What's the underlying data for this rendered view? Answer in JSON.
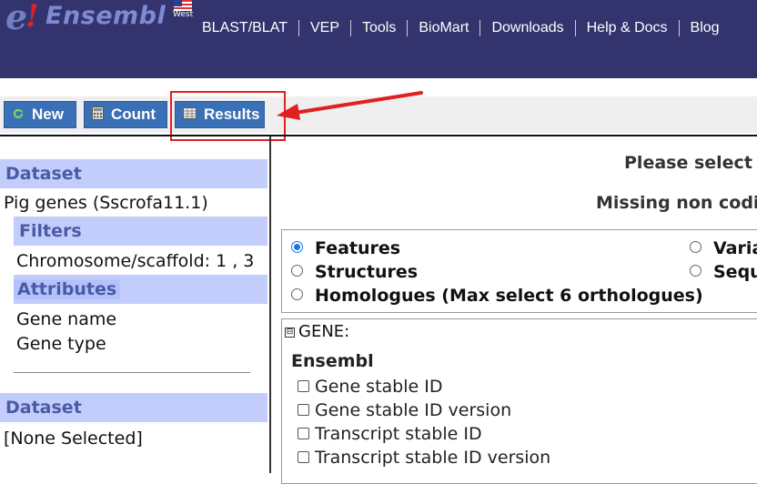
{
  "header": {
    "logo": {
      "e": "e",
      "bang": "!",
      "text": "Ensembl",
      "region": "West"
    },
    "nav": [
      "BLAST/BLAT",
      "VEP",
      "Tools",
      "BioMart",
      "Downloads",
      "Help & Docs",
      "Blog"
    ]
  },
  "toolbar": {
    "new_label": "New",
    "count_label": "Count",
    "results_label": "Results"
  },
  "sidebar": {
    "dataset_heading": "Dataset",
    "dataset_value": "Pig genes (Sscrofa11.1)",
    "filters_heading": "Filters",
    "filter_value": "Chromosome/scaffold: 1 , 3",
    "attributes_heading": "Attributes",
    "attributes": [
      "Gene name",
      "Gene type"
    ],
    "dataset2_heading": "Dataset",
    "dataset2_value": "[None Selected]"
  },
  "main": {
    "title": "Please select c",
    "subtitle": "Missing non codi",
    "attribute_pages": [
      {
        "label": "Features",
        "selected": true
      },
      {
        "label": "Structures",
        "selected": false
      },
      {
        "label": "Homologues (Max select 6 orthologues)",
        "selected": false
      },
      {
        "label": "Varia",
        "selected": false
      },
      {
        "label": "Sequ",
        "selected": false
      }
    ],
    "gene_section": "GENE:",
    "gene_toggle": "⊟",
    "ensembl_heading": "Ensembl",
    "checkboxes": [
      "Gene stable ID",
      "Gene stable ID version",
      "Transcript stable ID",
      "Transcript stable ID version"
    ]
  },
  "colors": {
    "header_bg": "#33336d",
    "button_bg": "#3a70b5",
    "sidebar_heading_bg": "#c3cdfb",
    "annotation_red": "#e02020"
  }
}
